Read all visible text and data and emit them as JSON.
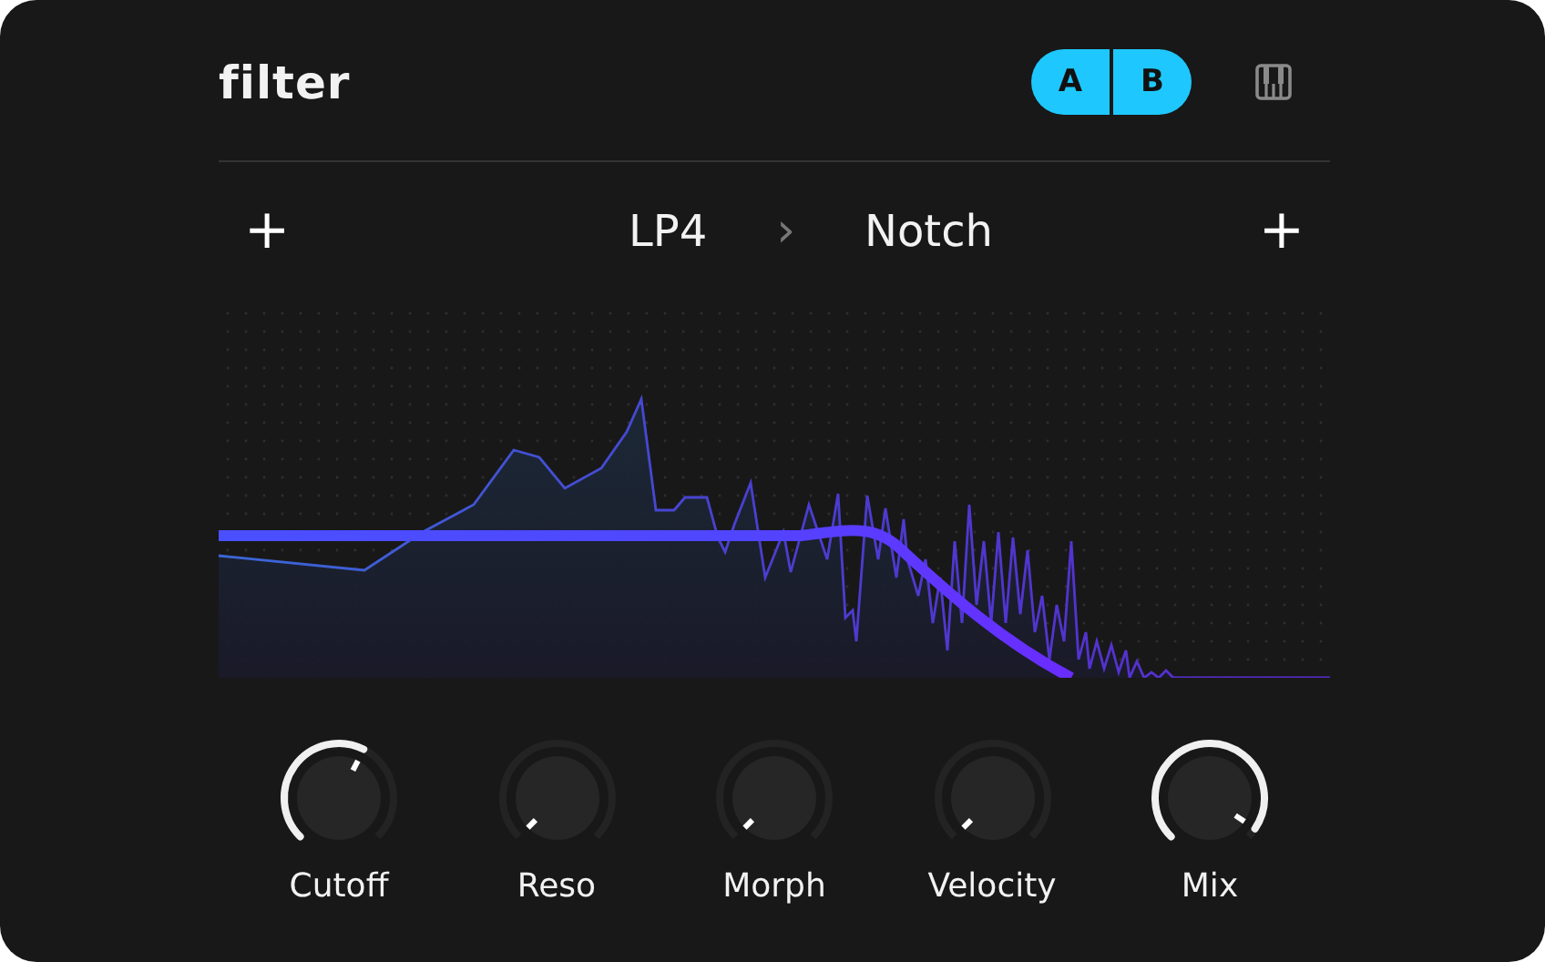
{
  "title": "filter",
  "ab": [
    "A",
    "B"
  ],
  "chain": {
    "add_left": "+",
    "first": "LP4",
    "separator": "›",
    "second": "Notch",
    "add_right": "+"
  },
  "knobs": [
    {
      "label": "Cutoff"
    },
    {
      "label": "Reso"
    },
    {
      "label": "Morph"
    },
    {
      "label": "Velocity"
    },
    {
      "label": "Mix"
    }
  ]
}
